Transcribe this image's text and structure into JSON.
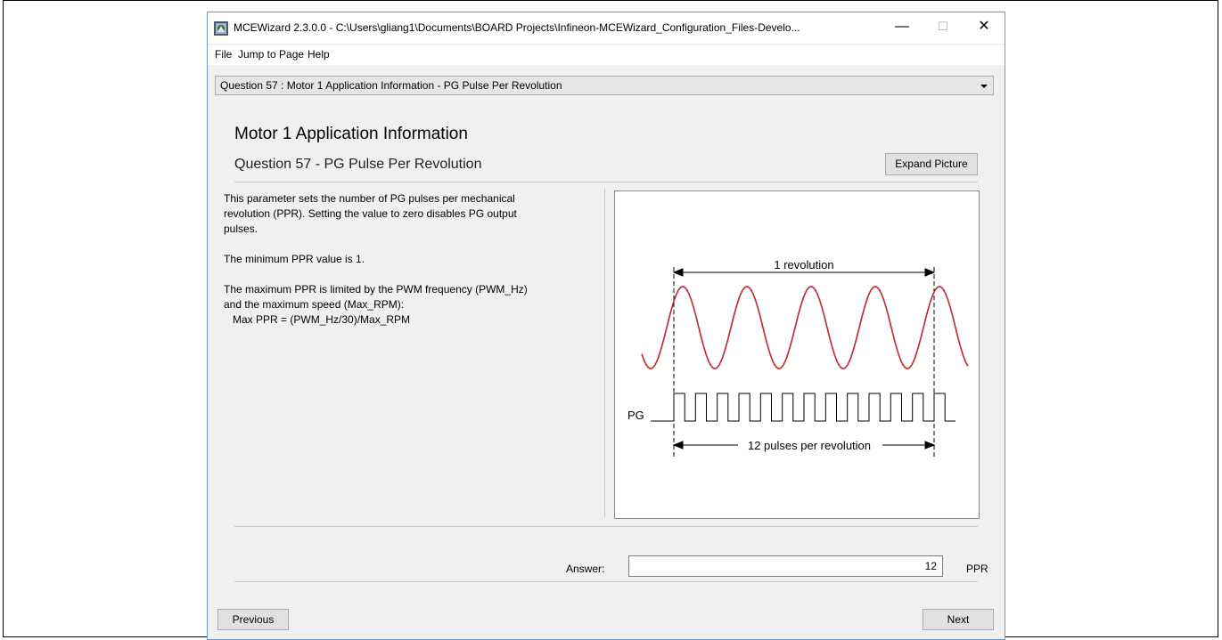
{
  "window": {
    "title": "MCEWizard 2.3.0.0  - C:\\Users\\gliang1\\Documents\\BOARD Projects\\Infineon-MCEWizard_Configuration_Files-Develo...",
    "minimize": "—",
    "maximize": "☐",
    "close": "✕",
    "icon": "mcewizard-app-icon"
  },
  "menu": {
    "items": [
      {
        "label": "File"
      },
      {
        "label": "Jump to Page"
      },
      {
        "label": "Help"
      }
    ]
  },
  "question_selector": {
    "selected": "Question  57 : Motor 1 Application Information - PG Pulse Per Revolution"
  },
  "page": {
    "title": "Motor 1 Application Information",
    "question": "Question 57 - PG Pulse Per Revolution",
    "expand_button": "Expand Picture"
  },
  "description": {
    "paragraphs": [
      "This parameter sets the number of PG pulses per mechanical\nrevolution (PPR). Setting the value to zero disables PG output\npulses.",
      "The minimum PPR value is 1.",
      "The maximum PPR is limited by the PWM frequency (PWM_Hz)\nand the maximum speed (Max_RPM):\n   Max PPR = (PWM_Hz/30)/Max_RPM"
    ]
  },
  "picture": {
    "revolution_label": "1 revolution",
    "pg_label": "PG",
    "pulses_label": "12 pulses per revolution",
    "sine_color": "#c0282d",
    "pulse_count": 12
  },
  "answer": {
    "label": "Answer:",
    "value": "12",
    "unit": "PPR"
  },
  "nav": {
    "previous": "Previous",
    "next": "Next"
  }
}
